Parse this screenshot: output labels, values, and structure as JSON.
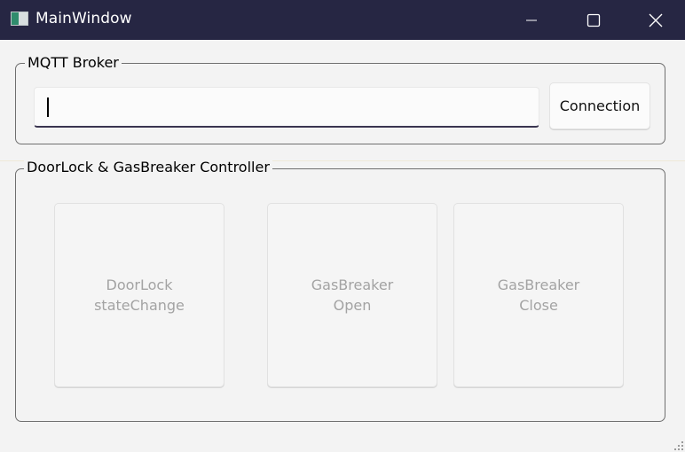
{
  "window": {
    "title": "MainWindow"
  },
  "broker_group": {
    "title": "MQTT Broker",
    "input_value": "",
    "connect_label": "Connection"
  },
  "controller_group": {
    "title": "DoorLock & GasBreaker Controller",
    "buttons": [
      {
        "line1": "DoorLock",
        "line2": "stateChange"
      },
      {
        "line1": "GasBreaker",
        "line2": "Open"
      },
      {
        "line1": "GasBreaker",
        "line2": "Close"
      }
    ]
  }
}
